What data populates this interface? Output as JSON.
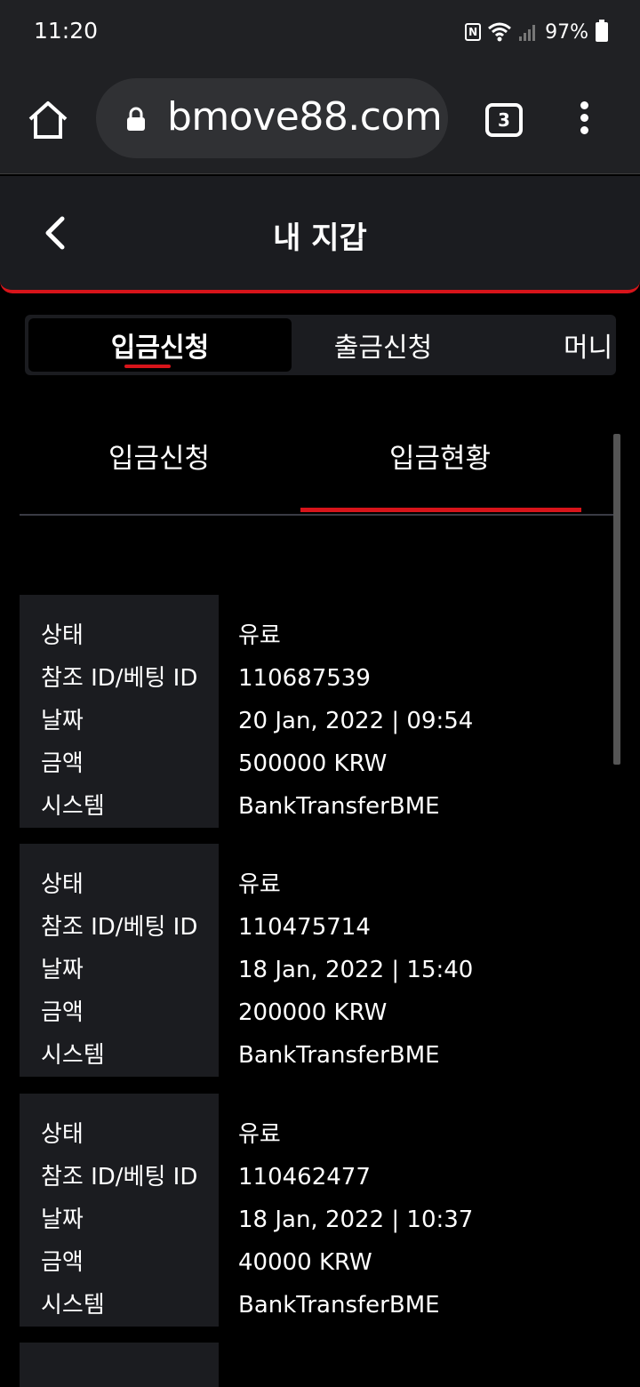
{
  "status_bar": {
    "time": "11:20",
    "battery": "97%",
    "icons": [
      "nfc-icon",
      "wifi-icon",
      "signal-icon",
      "battery-icon"
    ]
  },
  "browser": {
    "url": "bmove88.com",
    "tab_count": "3",
    "icons": [
      "home-icon",
      "lock-icon",
      "tabs-icon",
      "more-vert-icon"
    ]
  },
  "header": {
    "title": "내 지갑",
    "back_icon": "chevron-left-icon"
  },
  "main_tabs": [
    {
      "label": "입금신청",
      "active": true
    },
    {
      "label": "출금신청",
      "active": false
    },
    {
      "label": "머니",
      "active": false
    }
  ],
  "sub_tabs": [
    {
      "label": "입금신청",
      "active": false
    },
    {
      "label": "입금현황",
      "active": true
    }
  ],
  "field_labels": {
    "status": "상태",
    "ref_id": "참조 ID/베팅 ID",
    "date": "날짜",
    "amount": "금액",
    "system": "시스템"
  },
  "records": [
    {
      "status": "유료",
      "ref_id": "110687539",
      "date": "20 Jan, 2022 | 09:54",
      "amount": "500000 KRW",
      "system": "BankTransferBME"
    },
    {
      "status": "유료",
      "ref_id": "110475714",
      "date": "18 Jan, 2022 | 15:40",
      "amount": "200000 KRW",
      "system": "BankTransferBME"
    },
    {
      "status": "유료",
      "ref_id": "110462477",
      "date": "18 Jan, 2022 | 10:37",
      "amount": "40000 KRW",
      "system": "BankTransferBME"
    }
  ],
  "colors": {
    "accent": "#d7141a",
    "panel": "#1b1c20",
    "background": "#000000"
  }
}
